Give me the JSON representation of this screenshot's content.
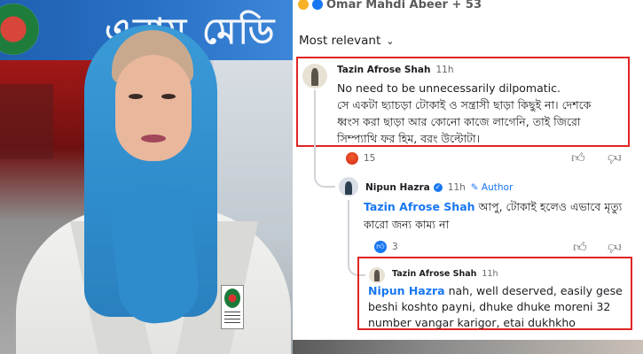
{
  "photo": {
    "sign_text": "এনাম মেডি",
    "description_icon": "doctor-portrait"
  },
  "feed": {
    "reactions_header": "Omar Mahdi Abeer + 53",
    "sort_label": "Most relevant"
  },
  "comments": [
    {
      "author": "Tazin Afrose Shah",
      "time": "11h",
      "lines": [
        "No need to be unnecessarily dilpomatic.",
        "সে একটা ছ্যাচড়া টোকাই ও সন্ত্রাসী ছাড়া কিছুই না। দেশকে",
        "ধ্বংস করা ছাড়া আর কোনো কাজে লাগেনি, তাই জিরো",
        "সিম্প্যাথি ফর হিম, বরং উল্টোটা।"
      ],
      "reaction_count": "15"
    },
    {
      "author": "Nipun Hazra",
      "time": "11h",
      "author_badge": "Author",
      "mention": "Tazin Afrose Shah",
      "line1_rest": " আপু, টোকাই হলেও এভাবে মৃত্যু",
      "line2": "কারো জন্য কাম্য না",
      "reaction_count": "3"
    },
    {
      "author": "Tazin Afrose Shah",
      "time": "11h",
      "mention": "Nipun Hazra",
      "line1_rest": " nah, well deserved, easily gese",
      "line2": "beshi koshto payni, dhuke dhuke moreni 32",
      "line3": "number vangar karigor, etai dukhkho"
    }
  ],
  "colors": {
    "highlight_box": "#e02424",
    "link_blue": "#1877f2",
    "scarf_blue": "#2f8ccc"
  }
}
